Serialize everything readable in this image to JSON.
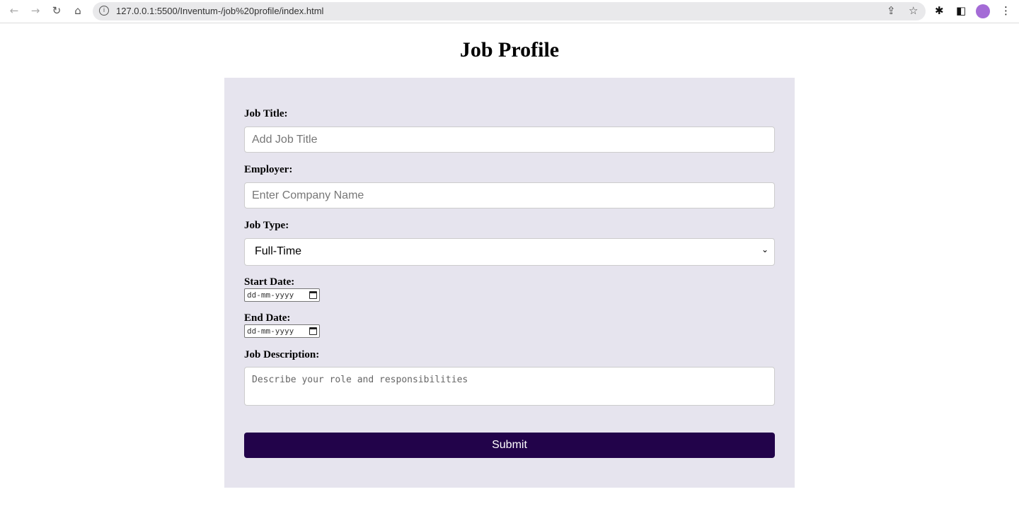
{
  "browser": {
    "url": "127.0.0.1:5500/Inventum-/job%20profile/index.html"
  },
  "page": {
    "title": "Job Profile"
  },
  "form": {
    "job_title": {
      "label": "Job Title:",
      "placeholder": "Add Job Title"
    },
    "employer": {
      "label": "Employer:",
      "placeholder": "Enter Company Name"
    },
    "job_type": {
      "label": "Job Type:",
      "value": "Full-Time"
    },
    "start_date": {
      "label": "Start Date:",
      "placeholder": "dd-mm-yyyy"
    },
    "end_date": {
      "label": "End Date:",
      "placeholder": "dd-mm-yyyy"
    },
    "description": {
      "label": "Job Description:",
      "placeholder": "Describe your role and responsibilities"
    },
    "submit": "Submit"
  },
  "colors": {
    "panel": "#e6e4ee",
    "button": "#22034a"
  }
}
